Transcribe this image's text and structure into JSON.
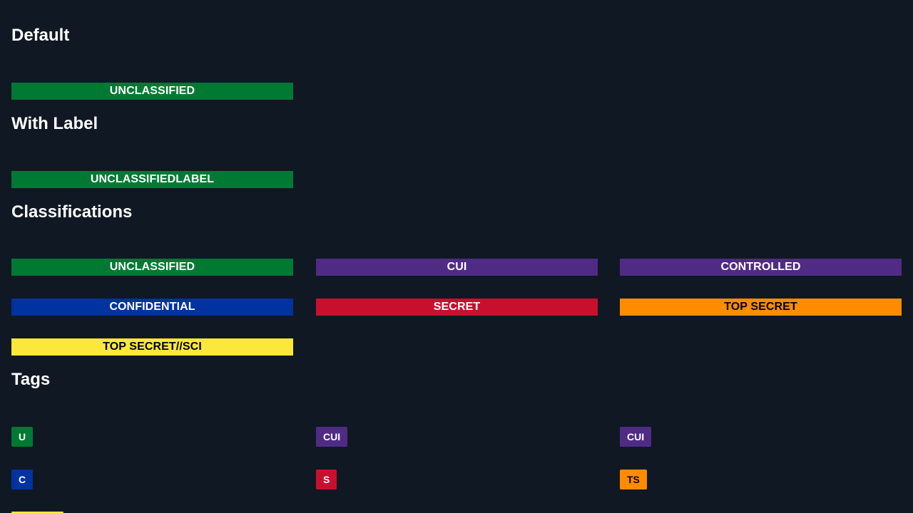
{
  "sections": {
    "default": {
      "title": "Default",
      "banner": "UNCLASSIFIED"
    },
    "with_label": {
      "title": "With Label",
      "banner_classification": "UNCLASSIFIED",
      "banner_label": "LABEL"
    },
    "classifications": {
      "title": "Classifications",
      "items": [
        "UNCLASSIFIED",
        "CUI",
        "CONTROLLED",
        "CONFIDENTIAL",
        "SECRET",
        "TOP SECRET",
        "TOP SECRET//SCI"
      ]
    },
    "tags": {
      "title": "Tags",
      "items": [
        "U",
        "CUI",
        "CUI",
        "C",
        "S",
        "TS",
        ""
      ]
    }
  },
  "colors": {
    "background": "#101823",
    "unclassified": "#007a33",
    "cui": "#502b85",
    "controlled": "#502b85",
    "confidential": "#0033a0",
    "secret": "#c8102e",
    "top_secret": "#ff8c00",
    "top_secret_sci": "#fce83a"
  }
}
